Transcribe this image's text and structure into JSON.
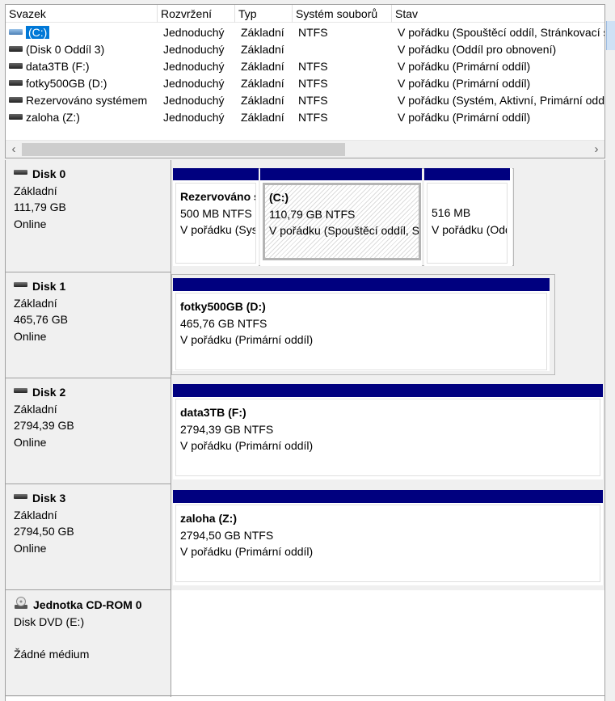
{
  "volume_list": {
    "columns": [
      "Svazek",
      "Rozvržení",
      "Typ",
      "Systém souborů",
      "Stav"
    ],
    "rows": [
      {
        "volume": "(C:)",
        "layout": "Jednoduchý",
        "type": "Základní",
        "fs": "NTFS",
        "status": "V pořádku (Spouštěcí oddíl, Stránkovací soubor"
      },
      {
        "volume": "(Disk 0 Oddíl 3)",
        "layout": "Jednoduchý",
        "type": "Základní",
        "fs": "",
        "status": "V pořádku (Oddíl pro obnovení)"
      },
      {
        "volume": "data3TB (F:)",
        "layout": "Jednoduchý",
        "type": "Základní",
        "fs": "NTFS",
        "status": "V pořádku (Primární oddíl)"
      },
      {
        "volume": "fotky500GB (D:)",
        "layout": "Jednoduchý",
        "type": "Základní",
        "fs": "NTFS",
        "status": "V pořádku (Primární oddíl)"
      },
      {
        "volume": "Rezervováno systémem",
        "layout": "Jednoduchý",
        "type": "Základní",
        "fs": "NTFS",
        "status": "V pořádku (Systém, Aktivní, Primární oddíl)"
      },
      {
        "volume": "zaloha (Z:)",
        "layout": "Jednoduchý",
        "type": "Základní",
        "fs": "NTFS",
        "status": "V pořádku (Primární oddíl)"
      }
    ],
    "scroll_left": "‹",
    "scroll_right": "›"
  },
  "disks": [
    {
      "name": "Disk 0",
      "kind": "Základní",
      "size": "111,79 GB",
      "state": "Online",
      "partitions": [
        {
          "title": "Rezervováno systémem",
          "size_fs": "500 MB NTFS",
          "status": "V pořádku (Systém, Aktivní, Primární oddíl)"
        },
        {
          "title": "(C:)",
          "size_fs": "110,79 GB NTFS",
          "status": "V pořádku (Spouštěcí oddíl, Stránkovací soubor"
        },
        {
          "title": "",
          "size_fs": "516 MB",
          "status": "V pořádku (Oddíl pro obnovení)"
        }
      ]
    },
    {
      "name": "Disk 1",
      "kind": "Základní",
      "size": "465,76 GB",
      "state": "Online",
      "partitions": [
        {
          "title": "fotky500GB  (D:)",
          "size_fs": "465,76 GB NTFS",
          "status": "V pořádku (Primární oddíl)"
        }
      ]
    },
    {
      "name": "Disk 2",
      "kind": "Základní",
      "size": "2794,39 GB",
      "state": "Online",
      "partitions": [
        {
          "title": "data3TB  (F:)",
          "size_fs": "2794,39 GB NTFS",
          "status": "V pořádku (Primární oddíl)"
        }
      ]
    },
    {
      "name": "Disk 3",
      "kind": "Základní",
      "size": "2794,50 GB",
      "state": "Online",
      "partitions": [
        {
          "title": "zaloha  (Z:)",
          "size_fs": "2794,50 GB NTFS",
          "status": "V pořádku (Primární oddíl)"
        }
      ]
    }
  ],
  "cdrom": {
    "name": "Jednotka CD-ROM 0",
    "kind": "Disk DVD (E:)",
    "state": "Žádné médium"
  },
  "colors": {
    "partition_bar": "#00007f",
    "selection": "#0078d7",
    "panel": "#f0f0f0"
  }
}
